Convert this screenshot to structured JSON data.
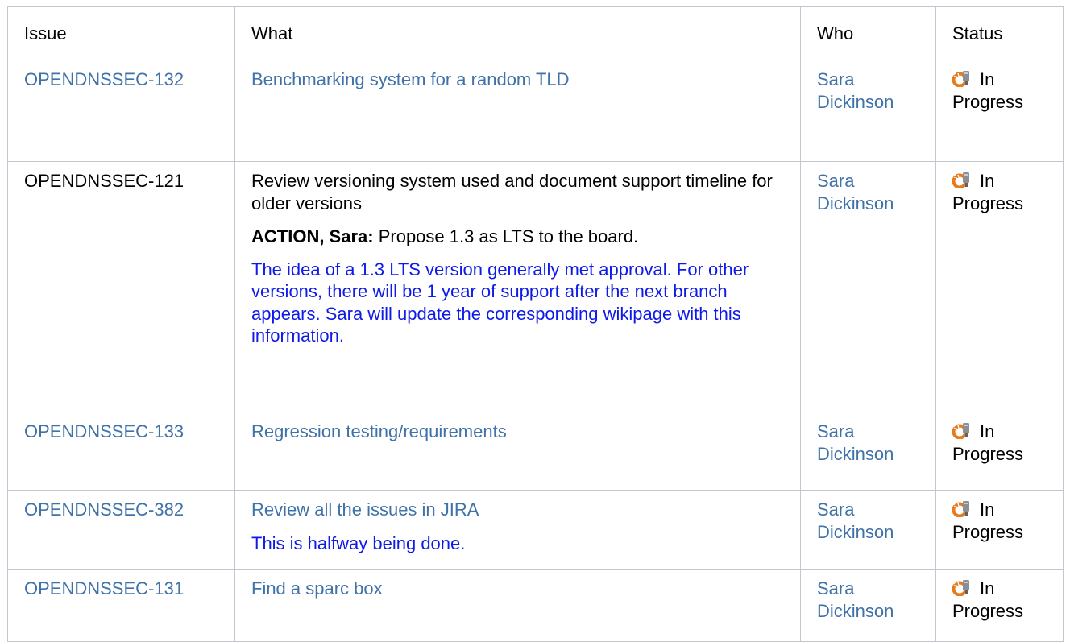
{
  "table": {
    "headers": {
      "issue": "Issue",
      "what": "What",
      "who": "Who",
      "status": "Status"
    },
    "rows": [
      {
        "issue": "OPENDNSSEC-132",
        "what": "Benchmarking system for a random TLD",
        "who": "Sara Dickinson",
        "status": "In Progress"
      },
      {
        "issue": "OPENDNSSEC-121",
        "what": "Review versioning system used and document support timeline for older versions",
        "action_label": "ACTION, Sara:",
        "action_text": " Propose 1.3 as LTS to the board.",
        "note": "The idea of a 1.3 LTS version generally met approval. For other versions, there will be 1 year of support after the next branch appears. Sara will update the corresponding wikipage with this information.",
        "who": "Sara Dickinson",
        "status": "In Progress"
      },
      {
        "issue": "OPENDNSSEC-133",
        "what": "Regression testing/requirements",
        "who": "Sara Dickinson",
        "status": "In Progress"
      },
      {
        "issue": "OPENDNSSEC-382",
        "what": "Review all the issues in JIRA",
        "note": "This is halfway being done.",
        "who": "Sara Dickinson",
        "status": "In Progress"
      },
      {
        "issue": "OPENDNSSEC-131",
        "what": "Find a sparc box",
        "who": "Sara Dickinson",
        "status": "In Progress"
      }
    ]
  },
  "icons": {
    "status": "in-progress-icon"
  },
  "colors": {
    "link": "#3f72a8",
    "note": "#0e1ae8",
    "border": "#c1c7d0",
    "icon_orange": "#e87a1c",
    "icon_gray": "#8a8f96"
  }
}
